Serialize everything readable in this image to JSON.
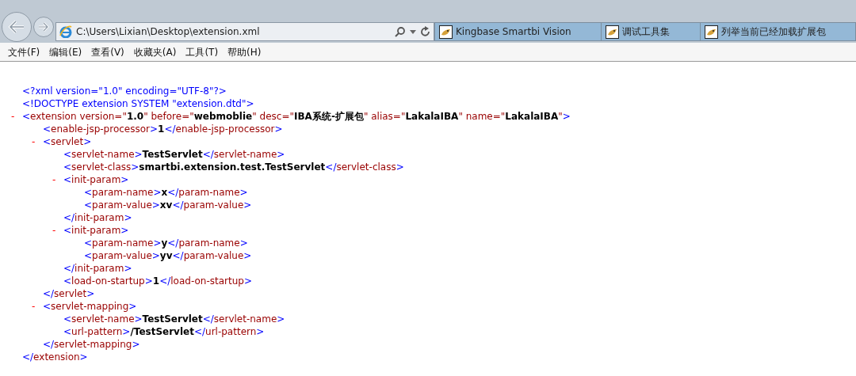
{
  "address_bar": {
    "value": "C:\\Users\\Lixian\\Desktop\\extension.xml"
  },
  "tabs": [
    {
      "label": "Kingbase Smartbi Vision",
      "selected": false
    },
    {
      "label": "调试工具集",
      "selected": false
    },
    {
      "label": "列举当前已经加载扩展包",
      "selected": false
    }
  ],
  "menu": [
    "文件(F)",
    "编辑(E)",
    "查看(V)",
    "收藏夹(A)",
    "工具(T)",
    "帮助(H)"
  ],
  "document": [
    {
      "line": [
        {
          "kind": "decl",
          "text": "<?xml version=\"1.0\" encoding=\"UTF-8\"?>"
        }
      ]
    },
    {
      "line": [
        {
          "kind": "decl",
          "text": "<!DOCTYPE extension SYSTEM \"extension.dtd\">"
        }
      ]
    },
    {
      "toggle": "-",
      "line": [
        {
          "kind": "punct",
          "text": "<"
        },
        {
          "kind": "name",
          "text": "extension"
        },
        {
          "kind": "attr",
          "text": " version=\""
        },
        {
          "kind": "value",
          "text": "1.0"
        },
        {
          "kind": "attr",
          "text": "\" before=\""
        },
        {
          "kind": "value",
          "text": "webmoblie"
        },
        {
          "kind": "attr",
          "text": "\" desc=\""
        },
        {
          "kind": "value",
          "text": "IBA系统-扩展包"
        },
        {
          "kind": "attr",
          "text": "\" alias=\""
        },
        {
          "kind": "value",
          "text": "LakalaIBA"
        },
        {
          "kind": "attr",
          "text": "\" name=\""
        },
        {
          "kind": "value",
          "text": "LakalaIBA"
        },
        {
          "kind": "attr",
          "text": "\""
        },
        {
          "kind": "punct",
          "text": ">"
        }
      ],
      "children": [
        {
          "line": [
            {
              "kind": "punct",
              "text": "<"
            },
            {
              "kind": "name",
              "text": "enable-jsp-processor"
            },
            {
              "kind": "punct",
              "text": ">"
            },
            {
              "kind": "value",
              "text": "1"
            },
            {
              "kind": "punct",
              "text": "</"
            },
            {
              "kind": "name",
              "text": "enable-jsp-processor"
            },
            {
              "kind": "punct",
              "text": ">"
            }
          ]
        },
        {
          "toggle": "-",
          "line": [
            {
              "kind": "punct",
              "text": "<"
            },
            {
              "kind": "name",
              "text": "servlet"
            },
            {
              "kind": "punct",
              "text": ">"
            }
          ],
          "children": [
            {
              "line": [
                {
                  "kind": "punct",
                  "text": "<"
                },
                {
                  "kind": "name",
                  "text": "servlet-name"
                },
                {
                  "kind": "punct",
                  "text": ">"
                },
                {
                  "kind": "value",
                  "text": "TestServlet"
                },
                {
                  "kind": "punct",
                  "text": "</"
                },
                {
                  "kind": "name",
                  "text": "servlet-name"
                },
                {
                  "kind": "punct",
                  "text": ">"
                }
              ]
            },
            {
              "line": [
                {
                  "kind": "punct",
                  "text": "<"
                },
                {
                  "kind": "name",
                  "text": "servlet-class"
                },
                {
                  "kind": "punct",
                  "text": ">"
                },
                {
                  "kind": "value",
                  "text": "smartbi.extension.test.TestServlet"
                },
                {
                  "kind": "punct",
                  "text": "</"
                },
                {
                  "kind": "name",
                  "text": "servlet-class"
                },
                {
                  "kind": "punct",
                  "text": ">"
                }
              ]
            },
            {
              "toggle": "-",
              "line": [
                {
                  "kind": "punct",
                  "text": "<"
                },
                {
                  "kind": "name",
                  "text": "init-param"
                },
                {
                  "kind": "punct",
                  "text": ">"
                }
              ],
              "children": [
                {
                  "line": [
                    {
                      "kind": "punct",
                      "text": "<"
                    },
                    {
                      "kind": "name",
                      "text": "param-name"
                    },
                    {
                      "kind": "punct",
                      "text": ">"
                    },
                    {
                      "kind": "value",
                      "text": "x"
                    },
                    {
                      "kind": "punct",
                      "text": "</"
                    },
                    {
                      "kind": "name",
                      "text": "param-name"
                    },
                    {
                      "kind": "punct",
                      "text": ">"
                    }
                  ]
                },
                {
                  "line": [
                    {
                      "kind": "punct",
                      "text": "<"
                    },
                    {
                      "kind": "name",
                      "text": "param-value"
                    },
                    {
                      "kind": "punct",
                      "text": ">"
                    },
                    {
                      "kind": "value",
                      "text": "xv"
                    },
                    {
                      "kind": "punct",
                      "text": "</"
                    },
                    {
                      "kind": "name",
                      "text": "param-value"
                    },
                    {
                      "kind": "punct",
                      "text": ">"
                    }
                  ]
                }
              ],
              "end": [
                {
                  "kind": "punct",
                  "text": "</"
                },
                {
                  "kind": "name",
                  "text": "init-param"
                },
                {
                  "kind": "punct",
                  "text": ">"
                }
              ]
            },
            {
              "toggle": "-",
              "line": [
                {
                  "kind": "punct",
                  "text": "<"
                },
                {
                  "kind": "name",
                  "text": "init-param"
                },
                {
                  "kind": "punct",
                  "text": ">"
                }
              ],
              "children": [
                {
                  "line": [
                    {
                      "kind": "punct",
                      "text": "<"
                    },
                    {
                      "kind": "name",
                      "text": "param-name"
                    },
                    {
                      "kind": "punct",
                      "text": ">"
                    },
                    {
                      "kind": "value",
                      "text": "y"
                    },
                    {
                      "kind": "punct",
                      "text": "</"
                    },
                    {
                      "kind": "name",
                      "text": "param-name"
                    },
                    {
                      "kind": "punct",
                      "text": ">"
                    }
                  ]
                },
                {
                  "line": [
                    {
                      "kind": "punct",
                      "text": "<"
                    },
                    {
                      "kind": "name",
                      "text": "param-value"
                    },
                    {
                      "kind": "punct",
                      "text": ">"
                    },
                    {
                      "kind": "value",
                      "text": "yv"
                    },
                    {
                      "kind": "punct",
                      "text": "</"
                    },
                    {
                      "kind": "name",
                      "text": "param-value"
                    },
                    {
                      "kind": "punct",
                      "text": ">"
                    }
                  ]
                }
              ],
              "end": [
                {
                  "kind": "punct",
                  "text": "</"
                },
                {
                  "kind": "name",
                  "text": "init-param"
                },
                {
                  "kind": "punct",
                  "text": ">"
                }
              ]
            },
            {
              "line": [
                {
                  "kind": "punct",
                  "text": "<"
                },
                {
                  "kind": "name",
                  "text": "load-on-startup"
                },
                {
                  "kind": "punct",
                  "text": ">"
                },
                {
                  "kind": "value",
                  "text": "1"
                },
                {
                  "kind": "punct",
                  "text": "</"
                },
                {
                  "kind": "name",
                  "text": "load-on-startup"
                },
                {
                  "kind": "punct",
                  "text": ">"
                }
              ]
            }
          ],
          "end": [
            {
              "kind": "punct",
              "text": "</"
            },
            {
              "kind": "name",
              "text": "servlet"
            },
            {
              "kind": "punct",
              "text": ">"
            }
          ]
        },
        {
          "toggle": "-",
          "line": [
            {
              "kind": "punct",
              "text": "<"
            },
            {
              "kind": "name",
              "text": "servlet-mapping"
            },
            {
              "kind": "punct",
              "text": ">"
            }
          ],
          "children": [
            {
              "line": [
                {
                  "kind": "punct",
                  "text": "<"
                },
                {
                  "kind": "name",
                  "text": "servlet-name"
                },
                {
                  "kind": "punct",
                  "text": ">"
                },
                {
                  "kind": "value",
                  "text": "TestServlet"
                },
                {
                  "kind": "punct",
                  "text": "</"
                },
                {
                  "kind": "name",
                  "text": "servlet-name"
                },
                {
                  "kind": "punct",
                  "text": ">"
                }
              ]
            },
            {
              "line": [
                {
                  "kind": "punct",
                  "text": "<"
                },
                {
                  "kind": "name",
                  "text": "url-pattern"
                },
                {
                  "kind": "punct",
                  "text": ">"
                },
                {
                  "kind": "value",
                  "text": "/TestServlet"
                },
                {
                  "kind": "punct",
                  "text": "</"
                },
                {
                  "kind": "name",
                  "text": "url-pattern"
                },
                {
                  "kind": "punct",
                  "text": ">"
                }
              ]
            }
          ],
          "end": [
            {
              "kind": "punct",
              "text": "</"
            },
            {
              "kind": "name",
              "text": "servlet-mapping"
            },
            {
              "kind": "punct",
              "text": ">"
            }
          ]
        }
      ],
      "end": [
        {
          "kind": "punct",
          "text": "</"
        },
        {
          "kind": "name",
          "text": "extension"
        },
        {
          "kind": "punct",
          "text": ">"
        }
      ]
    }
  ]
}
